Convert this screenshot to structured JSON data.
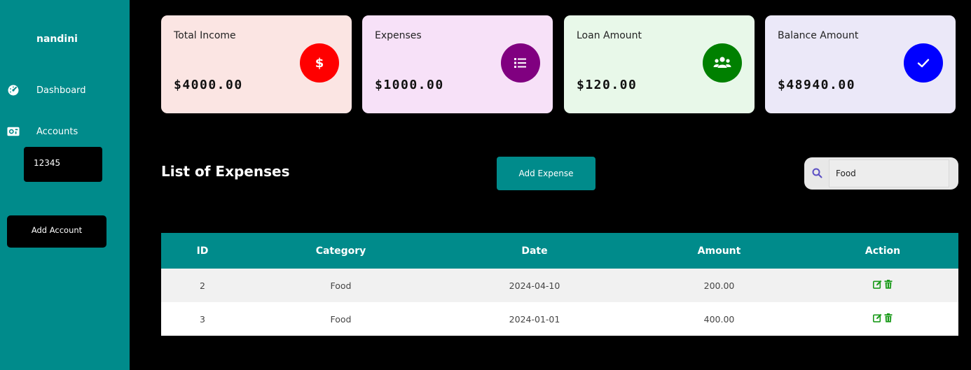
{
  "sidebar": {
    "username": "nandini",
    "items": [
      {
        "label": "Dashboard",
        "icon": "dashboard-gauge-icon"
      },
      {
        "label": "Accounts",
        "icon": "money-bill-icon"
      }
    ],
    "account_number": "12345",
    "add_account_label": "Add Account",
    "bg_color": "#008b8b"
  },
  "cards": [
    {
      "title": "Total Income",
      "amount": "$4000.00",
      "icon": "dollar-icon",
      "bg": "#fbe5e3",
      "badge": "#ff0000"
    },
    {
      "title": "Expenses",
      "amount": "$1000.00",
      "icon": "list-icon",
      "bg": "#f7e1f8",
      "badge": "#800080"
    },
    {
      "title": "Loan Amount",
      "amount": "$120.00",
      "icon": "users-icon",
      "bg": "#e8f8e9",
      "badge": "#008000"
    },
    {
      "title": "Balance Amount",
      "amount": "$48940.00",
      "icon": "check-icon",
      "bg": "#ebe8f8",
      "badge": "#0000ff"
    }
  ],
  "list": {
    "title": "List of Expenses",
    "add_label": "Add Expense",
    "search_value": "Food",
    "search_icon": "search-icon"
  },
  "table": {
    "headers": [
      "ID",
      "Category",
      "Date",
      "Amount",
      "Action"
    ],
    "rows": [
      {
        "id": "2",
        "category": "Food",
        "date": "2024-04-10",
        "amount": "200.00"
      },
      {
        "id": "3",
        "category": "Food",
        "date": "2024-01-01",
        "amount": "400.00"
      }
    ],
    "action_icons": [
      "edit-icon",
      "trash-icon"
    ]
  },
  "colors": {
    "accent": "#008b8b",
    "action_green": "#1a9a1a",
    "search_icon": "#5b4fc4"
  }
}
